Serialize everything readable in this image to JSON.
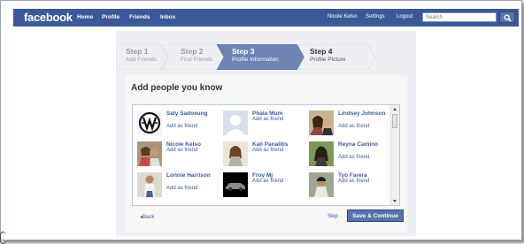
{
  "header": {
    "logo": "facebook",
    "nav": [
      "Home",
      "Profile",
      "Friends",
      "Inbox"
    ],
    "user_name": "Nicole Kelso",
    "settings": "Settings",
    "logout": "Logout",
    "search_placeholder": "Search"
  },
  "steps": [
    {
      "number": "Step 1",
      "label": "Add Friends",
      "state": "done"
    },
    {
      "number": "Step 2",
      "label": "Find Friends",
      "state": "done"
    },
    {
      "number": "Step 3",
      "label": "Profile Information",
      "state": "active"
    },
    {
      "number": "Step 4",
      "label": "Profile Picture",
      "state": "next"
    }
  ],
  "panel": {
    "title": "Add people you know",
    "add_label": "Add as friend",
    "people": [
      {
        "name": "Saly Sadoeung",
        "icon": "logo-avatar"
      },
      {
        "name": "Phala Mum",
        "icon": "default-silhouette-avatar"
      },
      {
        "name": "Lindsey Johnson",
        "icon": "photo-avatar"
      },
      {
        "name": "Nicole Kelso",
        "icon": "photo-avatar"
      },
      {
        "name": "Kali Panalitis",
        "icon": "photo-avatar"
      },
      {
        "name": "Reyna Camino",
        "icon": "photo-avatar"
      },
      {
        "name": "Lonnie Harrison",
        "icon": "photo-avatar"
      },
      {
        "name": "Froy Mj",
        "icon": "car-photo-avatar"
      },
      {
        "name": "Tyo Farera",
        "icon": "photo-avatar"
      }
    ]
  },
  "footer": {
    "back": "Back",
    "skip": "Skip",
    "save": "Save & Continue"
  },
  "colors": {
    "brand_blue": "#3b5998",
    "content_bg": "#edeff4",
    "active_step": "#6d84b4",
    "button": "#5b74a8"
  }
}
